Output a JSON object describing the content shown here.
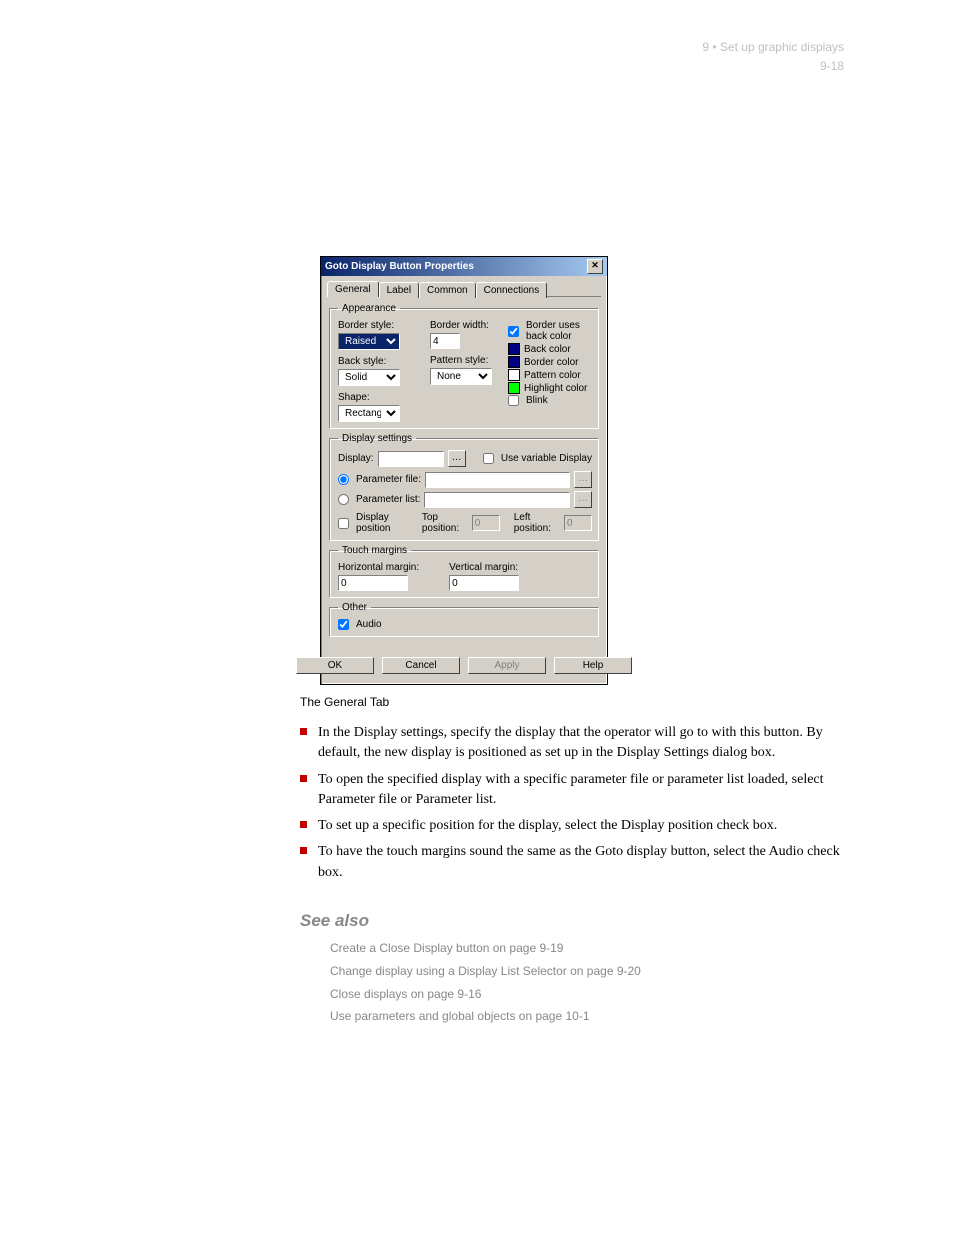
{
  "page_header": {
    "chapter": "9 • Set up graphic displays",
    "pagenum": "9-18"
  },
  "dialog": {
    "title": "Goto Display Button Properties",
    "tabs": [
      "General",
      "Label",
      "Common",
      "Connections"
    ],
    "appearance_legend": "Appearance",
    "border_style_label": "Border style:",
    "border_style_value": "Raised",
    "border_width_label": "Border width:",
    "border_width_value": "4",
    "back_style_label": "Back style:",
    "back_style_value": "Solid",
    "pattern_style_label": "Pattern style:",
    "pattern_style_value": "None",
    "shape_label": "Shape:",
    "shape_value": "Rectangle",
    "border_uses_back_label": "Border uses back color",
    "back_color_label": "Back color",
    "border_color_label": "Border color",
    "pattern_color_label": "Pattern color",
    "highlight_color_label": "Highlight color",
    "blink_label": "Blink",
    "colors": {
      "back": "#000080",
      "border": "#000080",
      "pattern": "#ffffff",
      "highlight": "#00ff00"
    },
    "display_settings_legend": "Display settings",
    "display_label": "Display:",
    "display_value": "",
    "use_variable_label": "Use variable Display",
    "parameter_file_label": "Parameter file:",
    "parameter_list_label": "Parameter list:",
    "display_position_label": "Display position",
    "top_position_label": "Top position:",
    "top_position_value": "0",
    "left_position_label": "Left position:",
    "left_position_value": "0",
    "touch_margins_legend": "Touch margins",
    "h_margin_label": "Horizontal  margin:",
    "h_margin_value": "0",
    "v_margin_label": "Vertical margin:",
    "v_margin_value": "0",
    "other_legend": "Other",
    "audio_label": "Audio",
    "buttons": {
      "ok": "OK",
      "cancel": "Cancel",
      "apply": "Apply",
      "help": "Help"
    }
  },
  "caption": "The General Tab",
  "bullets": [
    "In the Display settings, specify the display that the operator will go to with this button. By default, the new display is positioned as set up in the Display Settings dialog box.",
    "To open the specified display with a specific parameter file or parameter list loaded, select Parameter file or Parameter list.",
    "To set up a specific position for the display, select the Display position check box.",
    "To have the touch margins sound the same as the Goto display button, select the Audio check box."
  ],
  "see_also_heading": "See also",
  "see_also": [
    "Create a Close Display button on page 9-19",
    "Change display using a Display List Selector on page 9-20",
    "Close displays on page 9-16",
    "Use parameters and global objects on page 10-1"
  ]
}
